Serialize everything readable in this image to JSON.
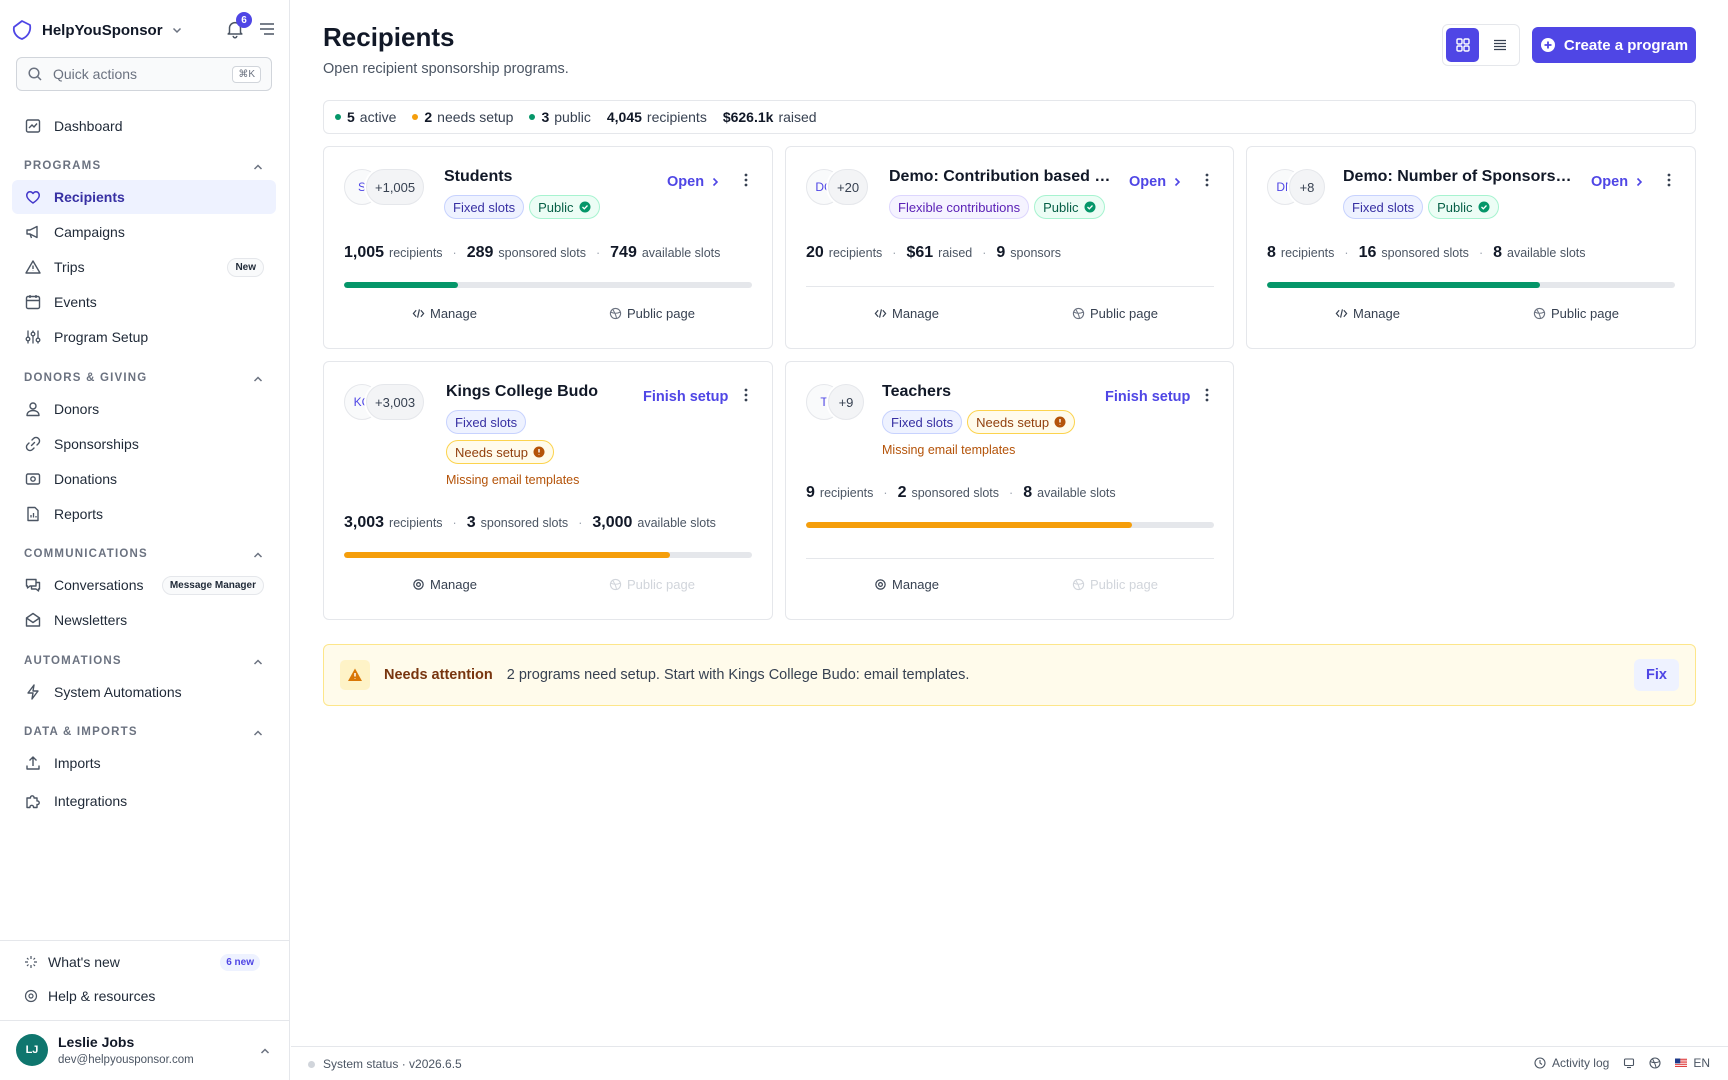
{
  "brand": {
    "name": "HelpYouSponsor",
    "notifications": "6"
  },
  "quick_actions": {
    "placeholder": "Quick actions",
    "shortcut": "⌘K"
  },
  "nav": {
    "dashboard": "Dashboard",
    "sections": [
      {
        "title": "PROGRAMS",
        "items": [
          {
            "label": "Recipients",
            "icon": "heart-icon",
            "active": true
          },
          {
            "label": "Campaigns",
            "icon": "megaphone-icon"
          },
          {
            "label": "Trips",
            "icon": "triangle-icon",
            "badge": "New"
          },
          {
            "label": "Events",
            "icon": "calendar-icon"
          },
          {
            "label": "Program Setup",
            "icon": "sliders-icon"
          }
        ]
      },
      {
        "title": "DONORS & GIVING",
        "items": [
          {
            "label": "Donors",
            "icon": "users-icon"
          },
          {
            "label": "Sponsorships",
            "icon": "link-icon"
          },
          {
            "label": "Donations",
            "icon": "donation-icon"
          },
          {
            "label": "Reports",
            "icon": "report-icon"
          }
        ]
      },
      {
        "title": "COMMUNICATIONS",
        "items": [
          {
            "label": "Conversations",
            "icon": "chat-icon",
            "badge": "Message Manager"
          },
          {
            "label": "Newsletters",
            "icon": "mail-icon"
          }
        ]
      },
      {
        "title": "AUTOMATIONS",
        "items": [
          {
            "label": "System Automations",
            "icon": "bolt-icon"
          }
        ]
      },
      {
        "title": "DATA & IMPORTS",
        "items": [
          {
            "label": "Imports",
            "icon": "upload-icon"
          },
          {
            "label": "Integrations",
            "icon": "puzzle-icon"
          }
        ]
      }
    ]
  },
  "bottom": {
    "whats_new": "What's new",
    "whats_new_count": "6 new",
    "help": "Help & resources"
  },
  "user": {
    "initials": "LJ",
    "name": "Leslie Jobs",
    "email": "dev@helpyousponsor.com"
  },
  "header": {
    "title": "Recipients",
    "subtitle": "Open recipient sponsorship programs.",
    "create_label": "Create a program"
  },
  "stats": [
    {
      "value": "5",
      "label": "active",
      "color": "#059669"
    },
    {
      "value": "2",
      "label": "needs setup",
      "color": "#f59e0b"
    },
    {
      "value": "3",
      "label": "public",
      "color": "#059669"
    },
    {
      "value": "4,045",
      "label": "recipients"
    },
    {
      "value": "$626.1k",
      "label": "raised"
    }
  ],
  "programs": [
    {
      "title": "Students",
      "initials": "S",
      "count": "+1,005",
      "chips": [
        {
          "label": "Fixed slots",
          "tone": "indigo"
        },
        {
          "label": "Public",
          "tone": "green",
          "icon": "check-circle-icon"
        }
      ],
      "action": "Open",
      "metrics": [
        {
          "value": "1,005",
          "label": "recipients"
        },
        {
          "value": "289",
          "label": "sponsored slots"
        },
        {
          "value": "749",
          "label": "available slots"
        }
      ],
      "progress": 0.28,
      "progress_color": "#059669",
      "manage": "Manage",
      "public_page": "Public page"
    },
    {
      "title": "Demo: Contribution based - …",
      "initials": "DC",
      "count": "+20",
      "chips": [
        {
          "label": "Flexible contributions",
          "tone": "purple"
        },
        {
          "label": "Public",
          "tone": "green",
          "icon": "check-circle-icon"
        }
      ],
      "action": "Open",
      "metrics": [
        {
          "value": "20",
          "label": "recipients"
        },
        {
          "value": "$61",
          "label": "raised"
        },
        {
          "value": "9",
          "label": "sponsors"
        }
      ],
      "manage": "Manage",
      "public_page": "Public page"
    },
    {
      "title": "Demo: Number of Sponsors -…",
      "initials": "DN",
      "count": "+8",
      "chips": [
        {
          "label": "Fixed slots",
          "tone": "indigo"
        },
        {
          "label": "Public",
          "tone": "green",
          "icon": "check-circle-icon"
        }
      ],
      "action": "Open",
      "metrics": [
        {
          "value": "8",
          "label": "recipients"
        },
        {
          "value": "16",
          "label": "sponsored slots"
        },
        {
          "value": "8",
          "label": "available slots"
        }
      ],
      "progress": 0.67,
      "progress_color": "#059669",
      "manage": "Manage",
      "public_page": "Public page"
    },
    {
      "title": "Kings College Budo",
      "initials": "KC",
      "count": "+3,003",
      "chips": [
        {
          "label": "Fixed slots",
          "tone": "indigo"
        }
      ],
      "chips2": [
        {
          "label": "Needs setup",
          "tone": "amber",
          "icon": "alert-circle-icon"
        }
      ],
      "warning": "Missing email templates",
      "action": "Finish setup",
      "metrics": [
        {
          "value": "3,003",
          "label": "recipients"
        },
        {
          "value": "3",
          "label": "sponsored slots"
        },
        {
          "value": "3,000",
          "label": "available slots"
        }
      ],
      "progress": 0.8,
      "progress_color": "#f59e0b",
      "manage": "Manage",
      "public_page": "Public page"
    },
    {
      "title": "Teachers",
      "initials": "T",
      "count": "+9",
      "chips": [
        {
          "label": "Fixed slots",
          "tone": "indigo"
        },
        {
          "label": "Needs setup",
          "tone": "amber",
          "icon": "alert-circle-icon"
        }
      ],
      "warning": "Missing email templates",
      "action": "Finish setup",
      "metrics": [
        {
          "value": "9",
          "label": "recipients"
        },
        {
          "value": "2",
          "label": "sponsored slots"
        },
        {
          "value": "8",
          "label": "available slots"
        }
      ],
      "progress": 0.8,
      "progress_color": "#f59e0b",
      "manage": "Manage",
      "public_page": "Public page"
    }
  ],
  "attention": {
    "title": "Needs attention",
    "text": "2 programs need setup. Start with Kings College Budo: email templates.",
    "fix": "Fix"
  },
  "footer": {
    "status": "System status · v2026.6.5",
    "activity": "Activity log",
    "lang": "EN"
  }
}
